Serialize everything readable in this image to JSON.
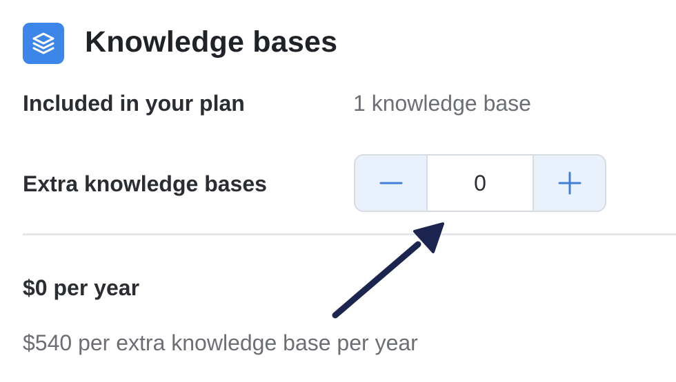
{
  "header": {
    "icon": "layers-icon",
    "title": "Knowledge bases",
    "accent_color": "#3d86e9"
  },
  "plan": {
    "label": "Included in your plan",
    "value": "1 knowledge base"
  },
  "extra": {
    "label": "Extra knowledge bases",
    "decrement_icon": "minus-icon",
    "increment_icon": "plus-icon",
    "value": "0"
  },
  "pricing": {
    "total": "$0 per year",
    "rate": "$540 per extra knowledge base per year"
  },
  "annotation": {
    "icon": "pointer-arrow-icon",
    "color": "#1c2550"
  }
}
